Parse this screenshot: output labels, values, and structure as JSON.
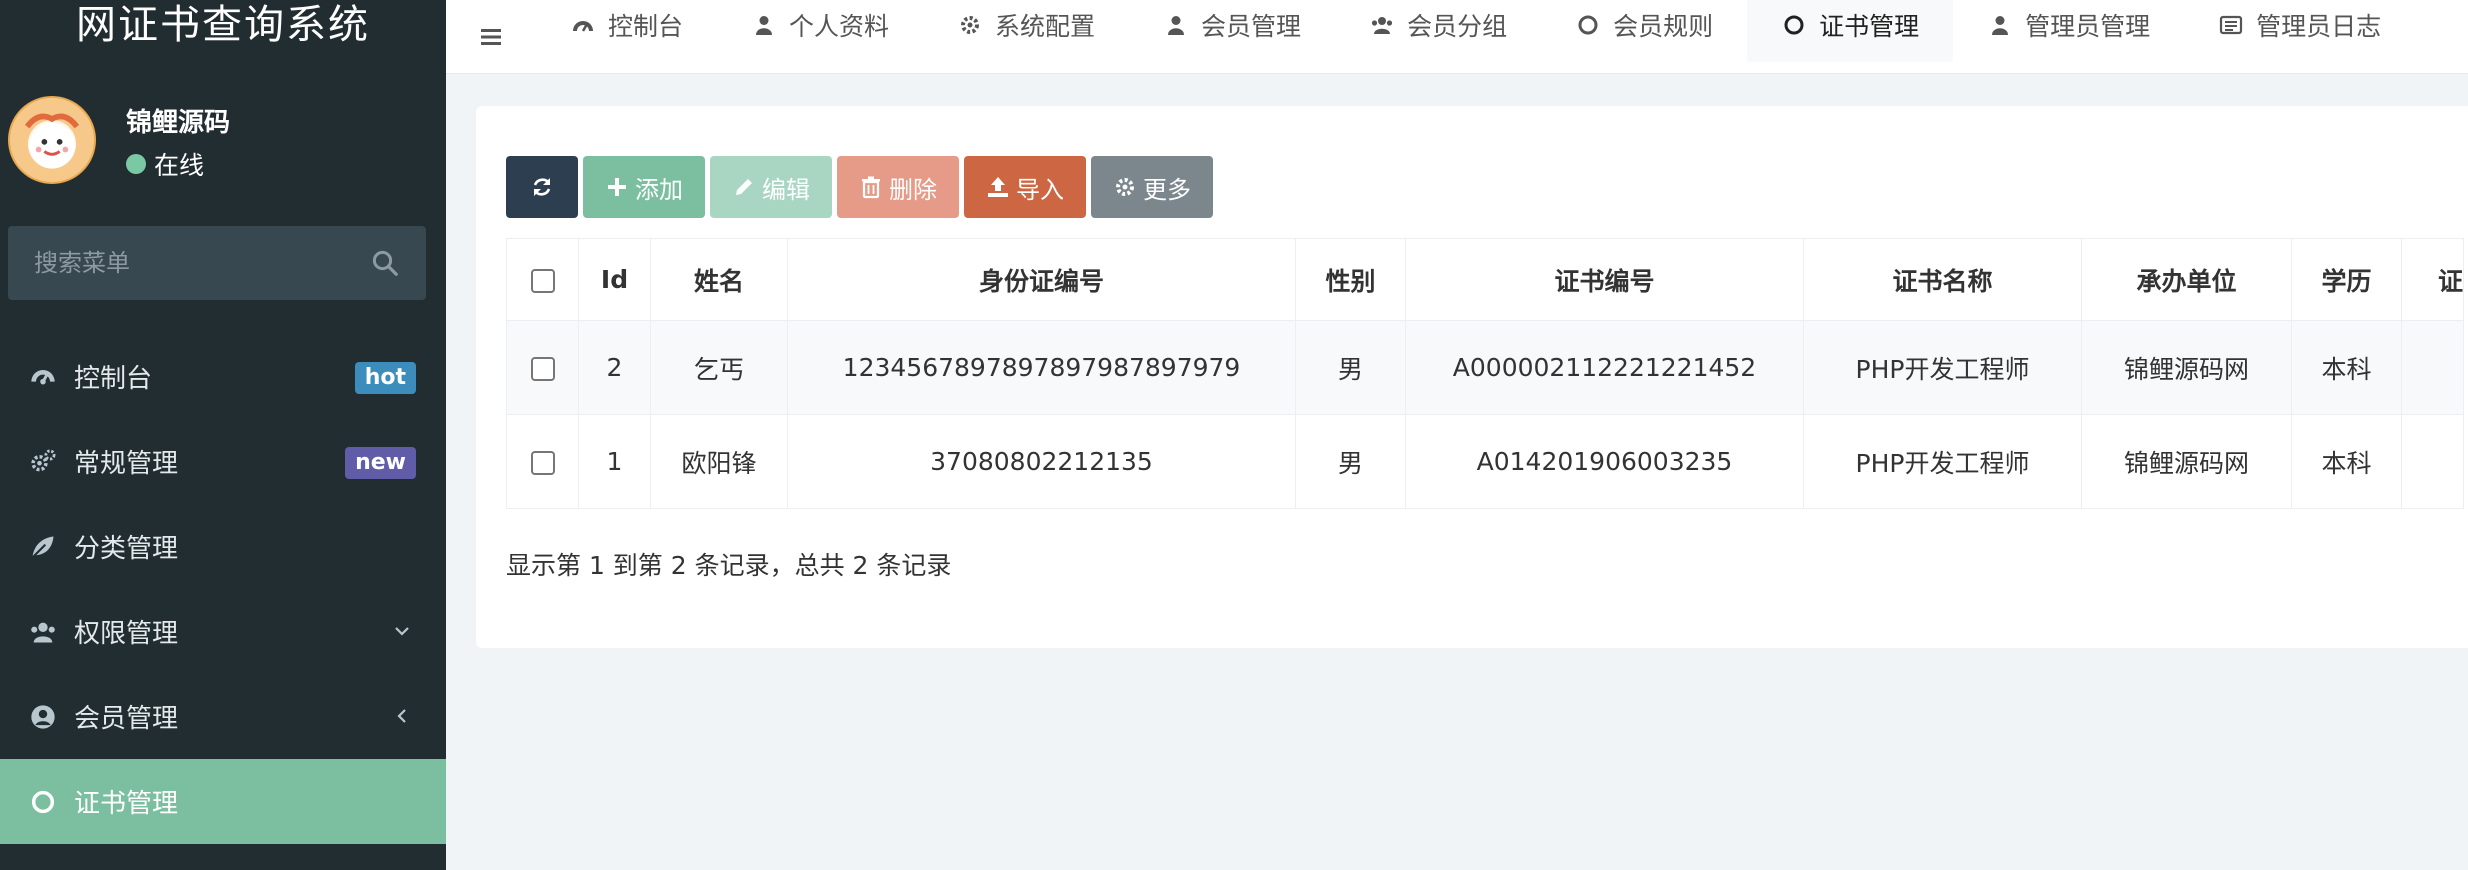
{
  "app": {
    "title": "网证书查询系统"
  },
  "user": {
    "name": "锦鲤源码",
    "status": "在线"
  },
  "sidebar": {
    "search_placeholder": "搜索菜单",
    "items": [
      {
        "label": "控制台",
        "icon": "dashboard-icon",
        "badge": "hot"
      },
      {
        "label": "常规管理",
        "icon": "cogs-icon",
        "badge": "new"
      },
      {
        "label": "分类管理",
        "icon": "leaf-icon"
      },
      {
        "label": "权限管理",
        "icon": "users-icon",
        "arrow": "chevron-down-icon"
      },
      {
        "label": "会员管理",
        "icon": "user-circle-icon",
        "arrow": "chevron-left-icon"
      },
      {
        "label": "证书管理",
        "icon": "circle-o-icon",
        "active": true
      }
    ]
  },
  "topnav": {
    "tabs": [
      {
        "label": "控制台",
        "icon": "dashboard-icon"
      },
      {
        "label": "个人资料",
        "icon": "user-icon"
      },
      {
        "label": "系统配置",
        "icon": "gear-icon"
      },
      {
        "label": "会员管理",
        "icon": "user-icon"
      },
      {
        "label": "会员分组",
        "icon": "users-icon"
      },
      {
        "label": "会员规则",
        "icon": "circle-o-icon"
      },
      {
        "label": "证书管理",
        "icon": "circle-o-icon",
        "active": true
      },
      {
        "label": "管理员管理",
        "icon": "user-icon"
      },
      {
        "label": "管理员日志",
        "icon": "list-icon"
      }
    ]
  },
  "toolbar": {
    "add_label": "添加",
    "edit_label": "编辑",
    "delete_label": "删除",
    "import_label": "导入",
    "more_label": "更多"
  },
  "table": {
    "columns": [
      "Id",
      "姓名",
      "身份证编号",
      "性别",
      "证书编号",
      "证书名称",
      "承办单位",
      "学历",
      "证"
    ],
    "rows": [
      [
        "2",
        "乞丐",
        "1234567897897897987897979",
        "男",
        "A000002112221221452",
        "PHP开发工程师",
        "锦鲤源码网",
        "本科",
        ""
      ],
      [
        "1",
        "欧阳锋",
        "37080802212135",
        "男",
        "A014201906003235",
        "PHP开发工程师",
        "锦鲤源码网",
        "本科",
        ""
      ]
    ]
  },
  "pagination": {
    "info": "显示第 1 到第 2 条记录，总共 2 条记录"
  },
  "colors": {
    "sidebar_bg": "#222d32",
    "accent": "#7bbfa0",
    "danger": "#e59b88",
    "import": "#cc6643"
  }
}
